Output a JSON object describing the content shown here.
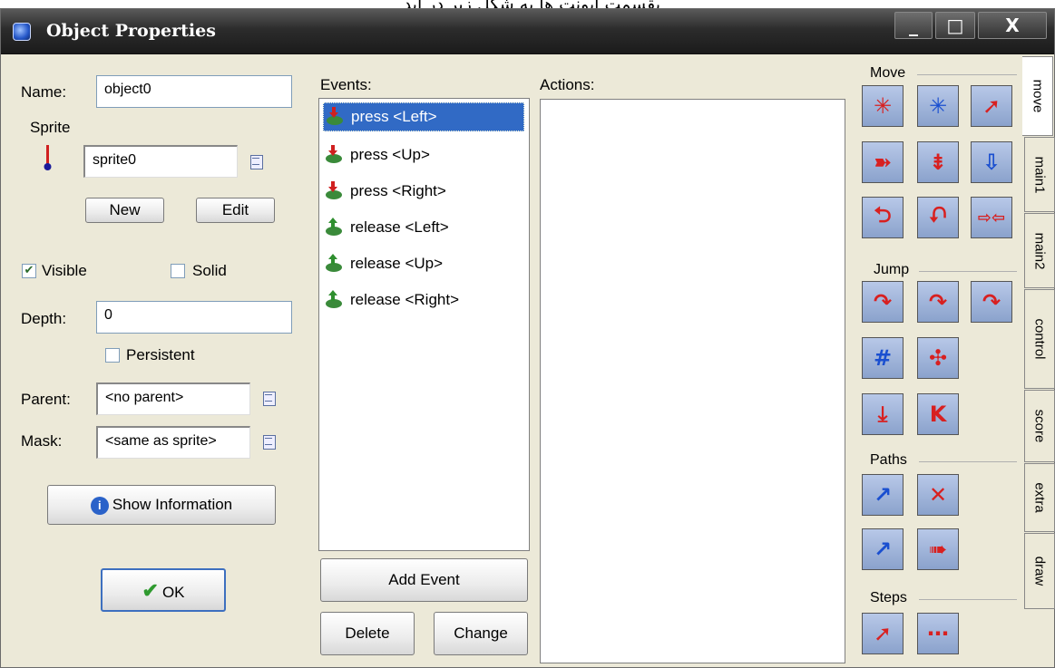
{
  "top_text": "یقسمت ایونت ها به شکل زیر در اید",
  "window": {
    "title": "Object Properties",
    "minimize": "_",
    "maximize": "□",
    "close": "X"
  },
  "left": {
    "name_label": "Name:",
    "name_value": "object0",
    "sprite_label": "Sprite",
    "sprite_value": "sprite0",
    "new_label": "New",
    "edit_label": "Edit",
    "visible_label": "Visible",
    "visible_checked": true,
    "solid_label": "Solid",
    "solid_checked": false,
    "depth_label": "Depth:",
    "depth_value": "0",
    "persistent_label": "Persistent",
    "persistent_checked": false,
    "parent_label": "Parent:",
    "parent_value": "<no parent>",
    "mask_label": "Mask:",
    "mask_value": "<same as sprite>",
    "show_info_label": "Show Information",
    "ok_label": "OK",
    "ok_icon": "checkmark-icon",
    "info_icon": "info-icon"
  },
  "events": {
    "label": "Events:",
    "items": [
      {
        "label": "press <Left>",
        "icon": "key-press-icon",
        "selected": true
      },
      {
        "label": "press <Up>",
        "icon": "key-press-icon",
        "selected": false
      },
      {
        "label": "press <Right>",
        "icon": "key-press-icon",
        "selected": false
      },
      {
        "label": "release <Left>",
        "icon": "key-release-icon",
        "selected": false
      },
      {
        "label": "release <Up>",
        "icon": "key-release-icon",
        "selected": false
      },
      {
        "label": "release <Right>",
        "icon": "key-release-icon",
        "selected": false
      }
    ],
    "add_event_label": "Add Event",
    "delete_label": "Delete",
    "change_label": "Change"
  },
  "actions": {
    "label": "Actions:"
  },
  "library": {
    "groups": [
      {
        "label": "Move"
      },
      {
        "label": "Jump"
      },
      {
        "label": "Paths"
      },
      {
        "label": "Steps"
      }
    ],
    "tabs": [
      "move",
      "main1",
      "main2",
      "control",
      "score",
      "extra",
      "draw"
    ],
    "active_tab": "move",
    "colors": {
      "action_bg": "#9fb4dc",
      "red": "#d82020",
      "blue": "#1a4fd0"
    }
  }
}
